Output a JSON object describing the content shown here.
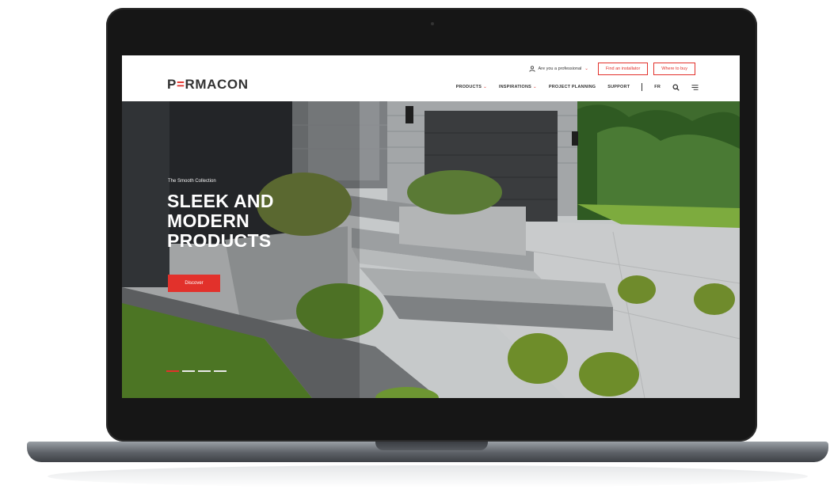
{
  "brand": {
    "logo_prefix": "P",
    "logo_accent": "=",
    "logo_suffix": "RMACON",
    "accent_color": "#e2312b"
  },
  "utility": {
    "professional_label": "Are you a professional",
    "professional_chevron": "⌄",
    "find_installer": "Find an installator",
    "where_to_buy": "Where to buy"
  },
  "nav": {
    "items": [
      {
        "label": "PRODUCTS",
        "has_dropdown": true
      },
      {
        "label": "INSPIRATIONS",
        "has_dropdown": true
      },
      {
        "label": "PROJECT PLANNING",
        "has_dropdown": false
      },
      {
        "label": "SUPPORT",
        "has_dropdown": false
      }
    ],
    "chevron": "⌄",
    "language": "FR",
    "icons": [
      "search-icon",
      "menu-icon"
    ]
  },
  "hero": {
    "kicker": "The Smooth Collection",
    "title_lines": [
      "SLEEK AND",
      "MODERN",
      "PRODUCTS"
    ],
    "cta": "Discover",
    "slides": 4,
    "active_slide": 1
  }
}
